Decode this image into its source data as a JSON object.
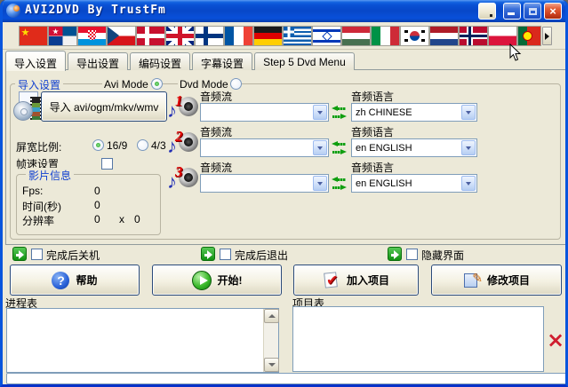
{
  "window": {
    "title": "AVI2DVD By TrustFm",
    "controls": {
      "minimize": "minimize",
      "maximize": "maximize",
      "close": "×"
    }
  },
  "language_bar": {
    "flags": [
      "china",
      "panama",
      "croatia",
      "czech-republic",
      "denmark",
      "united-kingdom",
      "finland",
      "france",
      "germany",
      "greece",
      "israel",
      "hungary",
      "italy",
      "south-korea",
      "netherlands",
      "norway",
      "poland",
      "portugal"
    ],
    "scroll_right": "▶"
  },
  "tabs": {
    "tab1": "导入设置",
    "tab2": "导出设置",
    "tab3": "编码设置",
    "tab4": "字幕设置",
    "tab5": "Step 5 Dvd Menu",
    "active_tab": "导入设置"
  },
  "import_panel": {
    "group_title": "导入设置",
    "avi_mode_label": "Avi Mode",
    "dvd_mode_label": "Dvd Mode",
    "avi_mode_selected": true,
    "dvd_mode_selected": false,
    "import_button_label": "导入 avi/ogm/mkv/wmv",
    "audio_rows": [
      {
        "num": "1",
        "stream_label": "音频流",
        "stream_value": "",
        "lang_label": "音频语言",
        "lang_value": "zh CHINESE"
      },
      {
        "num": "2",
        "stream_label": "音频流",
        "stream_value": "",
        "lang_label": "音频语言",
        "lang_value": "en ENGLISH"
      },
      {
        "num": "3",
        "stream_label": "音频流",
        "stream_value": "",
        "lang_label": "音频语言",
        "lang_value": "en ENGLISH"
      }
    ],
    "aspect": {
      "label": "屏宽比例:",
      "option1": "16/9",
      "option2": "4/3",
      "selected": "16/9"
    },
    "framerate_label": "帧速设置",
    "framerate_checked": false,
    "movie_info": {
      "title": "影片信息",
      "fps_label": "Fps:",
      "fps_value": "0",
      "time_label": "时间(秒)",
      "time_value": "0",
      "res_label": "分辨率",
      "res_value": "0",
      "res_x": "x",
      "res_value2": "0"
    }
  },
  "options": {
    "shutdown": {
      "label": "完成后关机",
      "checked": false
    },
    "exit": {
      "label": "完成后退出",
      "checked": false
    },
    "hide": {
      "label": "隐藏界面",
      "checked": false
    }
  },
  "action_buttons": {
    "help": "帮助",
    "start": "开始!",
    "add_project": "加入项目",
    "edit_project": "修改项目"
  },
  "lists": {
    "progress_label": "进程表",
    "progress_content": "",
    "project_label": "项目表",
    "project_content": "",
    "status_bar": ""
  },
  "icons": {
    "help_glyph": "?",
    "add_glyph": "✔",
    "edit_glyph": "✎",
    "delete_glyph": "×"
  }
}
